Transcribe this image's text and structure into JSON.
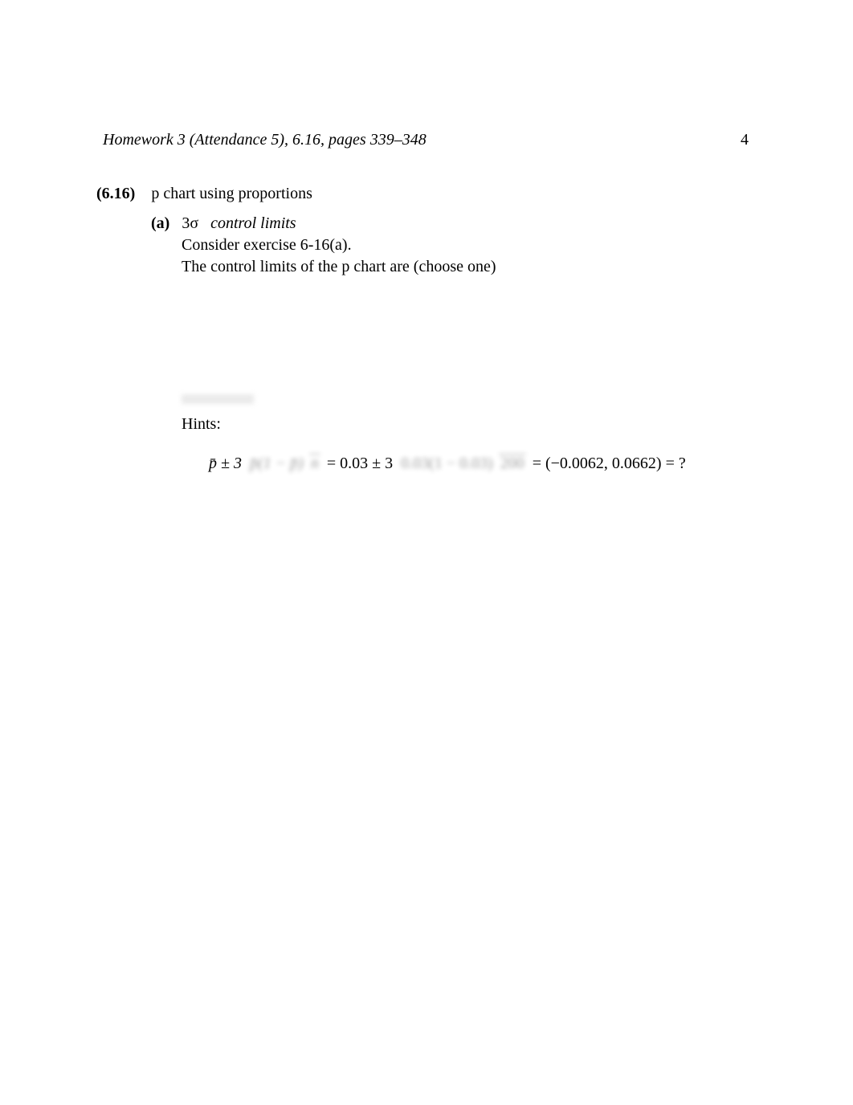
{
  "header": {
    "left": "Homework 3 (Attendance 5), 6.16, pages 339–348",
    "page_number": "4"
  },
  "problem": {
    "number": "(6.16)",
    "title": "p chart using proportions"
  },
  "part_a": {
    "label": "(a)",
    "heading_prefix": "3σ",
    "heading_rest": "control limits",
    "line1": "Consider exercise 6-16(a).",
    "line2": "The control limits of the p chart are (choose one)"
  },
  "hints_label": "Hints:",
  "equation": {
    "lhs_prefix": "p̄ ± 3",
    "frac1_num": "p̄(1 − p̄)",
    "frac1_den": "n",
    "mid": "= 0.03 ± 3",
    "frac2_num": "0.03(1 − 0.03)",
    "frac2_den": "200",
    "tail": "= (−0.0062, 0.0662) = ?"
  }
}
